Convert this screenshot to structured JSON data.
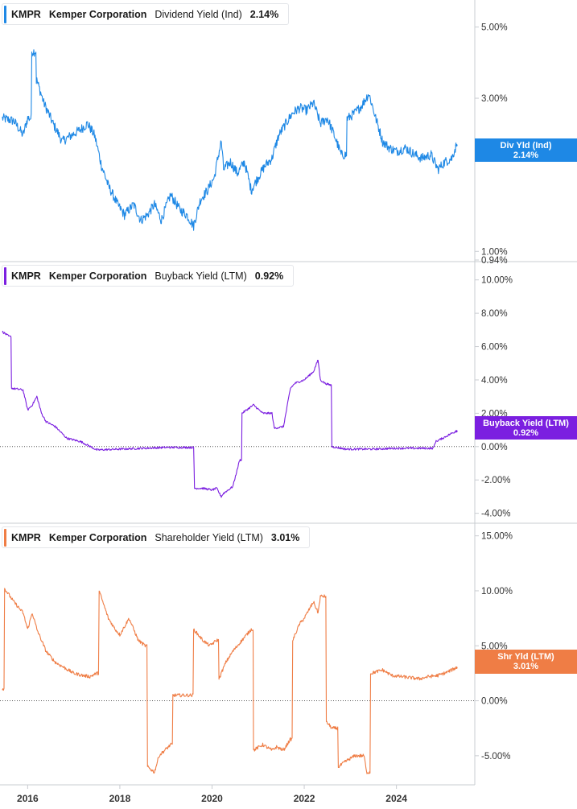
{
  "colors": {
    "dividend": "#1e88e5",
    "buyback": "#7b1fe0",
    "shareholder": "#ef7d45"
  },
  "x_axis": {
    "labels": [
      "2016",
      "2018",
      "2020",
      "2022",
      "2024"
    ],
    "range": [
      2015.4,
      2025.7
    ]
  },
  "panels": [
    {
      "id": "dividend",
      "legend": {
        "ticker": "KMPR",
        "company": "Kemper Corporation",
        "metric": "Dividend Yield (Ind)",
        "value": "2.14%"
      },
      "tag": {
        "line1": "Div Yld (Ind)",
        "line2": "2.14%"
      },
      "y_ticks": [
        "5.00%",
        "3.00%",
        "2.00%",
        "1.00%",
        "0.94%"
      ]
    },
    {
      "id": "buyback",
      "legend": {
        "ticker": "KMPR",
        "company": "Kemper Corporation",
        "metric": "Buyback Yield (LTM)",
        "value": "0.92%"
      },
      "tag": {
        "line1": "Buyback Yield (LTM)",
        "line2": "0.92%"
      },
      "y_ticks": [
        "10.00%",
        "8.00%",
        "6.00%",
        "4.00%",
        "2.00%",
        "0.00%",
        "-2.00%",
        "-4.00%"
      ]
    },
    {
      "id": "shareholder",
      "legend": {
        "ticker": "KMPR",
        "company": "Kemper Corporation",
        "metric": "Shareholder Yield (LTM)",
        "value": "3.01%"
      },
      "tag": {
        "line1": "Shr Yld (LTM)",
        "line2": "3.01%"
      },
      "y_ticks": [
        "15.00%",
        "10.00%",
        "5.00%",
        "0.00%",
        "-5.00%"
      ]
    }
  ],
  "chart_data": [
    {
      "type": "line",
      "series": [
        {
          "name": "Dividend Yield (Ind)",
          "x": [
            2015.45,
            2015.7,
            2015.9,
            2016.0,
            2016.1,
            2016.2,
            2016.35,
            2016.55,
            2016.75,
            2016.95,
            2017.15,
            2017.3,
            2017.45,
            2017.6,
            2017.75,
            2017.95,
            2018.1,
            2018.3,
            2018.45,
            2018.6,
            2018.75,
            2018.9,
            2019.1,
            2019.3,
            2019.45,
            2019.6,
            2019.75,
            2019.9,
            2020.05,
            2020.2,
            2020.25,
            2020.4,
            2020.55,
            2020.7,
            2020.85,
            2021.0,
            2021.15,
            2021.3,
            2021.45,
            2021.6,
            2021.75,
            2021.9,
            2022.05,
            2022.2,
            2022.35,
            2022.5,
            2022.65,
            2022.8,
            2022.95,
            2023.1,
            2023.25,
            2023.4,
            2023.55,
            2023.7,
            2023.85,
            2024.0,
            2024.2,
            2024.4,
            2024.55,
            2024.75,
            2024.9,
            2025.05,
            2025.2,
            2025.3
          ],
          "y": [
            2.6,
            2.55,
            2.3,
            2.6,
            4.2,
            3.4,
            2.9,
            2.5,
            2.2,
            2.3,
            2.4,
            2.5,
            2.3,
            1.85,
            1.6,
            1.4,
            1.3,
            1.4,
            1.25,
            1.3,
            1.4,
            1.25,
            1.5,
            1.35,
            1.3,
            1.2,
            1.45,
            1.55,
            1.7,
            2.2,
            1.8,
            1.9,
            1.75,
            1.9,
            1.55,
            1.7,
            1.85,
            1.95,
            2.3,
            2.5,
            2.7,
            2.8,
            2.75,
            2.9,
            2.5,
            2.6,
            2.3,
            2.0,
            2.6,
            2.7,
            2.85,
            3.1,
            2.6,
            2.2,
            2.1,
            2.05,
            2.1,
            2.0,
            1.95,
            2.0,
            1.8,
            1.9,
            1.95,
            2.14
          ]
        }
      ],
      "y_scale": "log",
      "ylim": [
        0.94,
        6.0
      ]
    },
    {
      "type": "line",
      "series": [
        {
          "name": "Buyback Yield (LTM)",
          "x": [
            2015.45,
            2015.6,
            2015.65,
            2015.9,
            2016.0,
            2016.1,
            2016.2,
            2016.3,
            2016.4,
            2016.6,
            2016.85,
            2017.15,
            2017.5,
            2018.0,
            2019.0,
            2019.6,
            2019.62,
            2019.8,
            2020.0,
            2020.1,
            2020.2,
            2020.25,
            2020.45,
            2020.6,
            2020.65,
            2020.9,
            2021.1,
            2021.3,
            2021.35,
            2021.55,
            2021.7,
            2021.8,
            2022.0,
            2022.2,
            2022.3,
            2022.35,
            2022.45,
            2022.55,
            2022.6,
            2022.9,
            2023.5,
            2024.0,
            2024.5,
            2024.8,
            2024.85,
            2025.0,
            2025.2,
            2025.3
          ],
          "y": [
            6.9,
            6.6,
            3.5,
            3.4,
            2.2,
            2.5,
            3.0,
            2.0,
            1.5,
            1.2,
            0.5,
            0.3,
            -0.2,
            -0.15,
            -0.05,
            -0.05,
            -2.5,
            -2.5,
            -2.6,
            -2.5,
            -3.0,
            -2.8,
            -2.4,
            -0.8,
            2.0,
            2.5,
            2.0,
            2.0,
            1.1,
            1.2,
            3.5,
            3.8,
            4.0,
            4.5,
            5.2,
            4.0,
            3.8,
            3.7,
            0.0,
            -0.15,
            -0.15,
            -0.1,
            -0.1,
            -0.1,
            0.3,
            0.5,
            0.8,
            0.92
          ]
        }
      ],
      "ylim": [
        -4.5,
        11.0
      ]
    },
    {
      "type": "line",
      "series": [
        {
          "name": "Shareholder Yield (LTM)",
          "x": [
            2015.45,
            2015.5,
            2015.7,
            2015.9,
            2016.0,
            2016.1,
            2016.2,
            2016.4,
            2016.6,
            2016.8,
            2017.0,
            2017.2,
            2017.35,
            2017.5,
            2017.55,
            2017.75,
            2017.9,
            2018.0,
            2018.2,
            2018.4,
            2018.55,
            2018.6,
            2018.75,
            2018.85,
            2019.1,
            2019.15,
            2019.4,
            2019.55,
            2019.6,
            2019.8,
            2019.95,
            2020.1,
            2020.15,
            2020.3,
            2020.45,
            2020.55,
            2020.65,
            2020.75,
            2020.85,
            2020.9,
            2021.1,
            2021.3,
            2021.4,
            2021.55,
            2021.7,
            2021.75,
            2021.9,
            2022.0,
            2022.2,
            2022.3,
            2022.35,
            2022.5,
            2022.6,
            2022.65,
            2022.75,
            2022.9,
            2023.1,
            2023.3,
            2023.35,
            2023.45,
            2023.7,
            2023.9,
            2024.1,
            2024.5,
            2024.7,
            2024.9,
            2025.1,
            2025.3
          ],
          "y": [
            1.1,
            10.2,
            9.0,
            8.0,
            6.5,
            8.0,
            6.5,
            4.5,
            3.5,
            3.0,
            2.5,
            2.3,
            2.2,
            2.5,
            10.0,
            7.5,
            6.5,
            6.0,
            7.5,
            5.5,
            5.0,
            -6.0,
            -6.5,
            -5.0,
            -4.0,
            0.5,
            0.5,
            0.5,
            6.5,
            5.5,
            5.0,
            5.5,
            2.0,
            3.5,
            4.5,
            5.0,
            5.5,
            6.0,
            6.5,
            -4.5,
            -4.0,
            -4.5,
            -4.2,
            -4.5,
            -3.5,
            5.5,
            7.0,
            7.5,
            9.0,
            8.0,
            9.5,
            -2.0,
            -2.5,
            -2.5,
            -6.0,
            -5.5,
            -5.0,
            -5.0,
            -6.5,
            2.5,
            2.8,
            2.3,
            2.2,
            2.0,
            2.2,
            2.3,
            2.6,
            3.01
          ]
        }
      ],
      "ylim": [
        -7.5,
        16.0
      ]
    }
  ]
}
